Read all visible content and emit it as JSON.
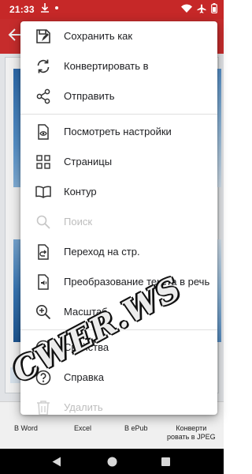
{
  "status_bar": {
    "time": "21:33"
  },
  "bottom_tools": [
    {
      "label": "В Word"
    },
    {
      "label": "Excel"
    },
    {
      "label": "В ePub"
    },
    {
      "label": "Конверти\nровать в JPEG"
    }
  ],
  "menu": {
    "items": [
      {
        "label": "Сохранить как",
        "icon": "save-as-icon",
        "enabled": true
      },
      {
        "label": "Конвертировать в",
        "icon": "convert-icon",
        "enabled": true
      },
      {
        "label": "Отправить",
        "icon": "share-icon",
        "enabled": true
      },
      {
        "label": "Посмотреть настройки",
        "icon": "view-settings-icon",
        "enabled": true
      },
      {
        "label": "Страницы",
        "icon": "pages-grid-icon",
        "enabled": true
      },
      {
        "label": "Контур",
        "icon": "outline-book-icon",
        "enabled": true
      },
      {
        "label": "Поиск",
        "icon": "search-icon",
        "enabled": false
      },
      {
        "label": "Переход на стр.",
        "icon": "go-to-page-icon",
        "enabled": true
      },
      {
        "label": "Преобразование текста в речь",
        "icon": "text-to-speech-icon",
        "enabled": true
      },
      {
        "label": "Масштаб",
        "icon": "zoom-icon",
        "enabled": true
      },
      {
        "label": "Свойства",
        "icon": "info-icon",
        "enabled": true
      },
      {
        "label": "Справка",
        "icon": "help-icon",
        "enabled": true
      },
      {
        "label": "Удалить",
        "icon": "delete-icon",
        "enabled": false
      }
    ]
  },
  "watermark": {
    "text": "CWER.WS"
  },
  "colors": {
    "status_bar": "#c62828",
    "app_bar": "#d32f2f",
    "menu_text": "#202124",
    "disabled_text": "#bdbdbd"
  }
}
